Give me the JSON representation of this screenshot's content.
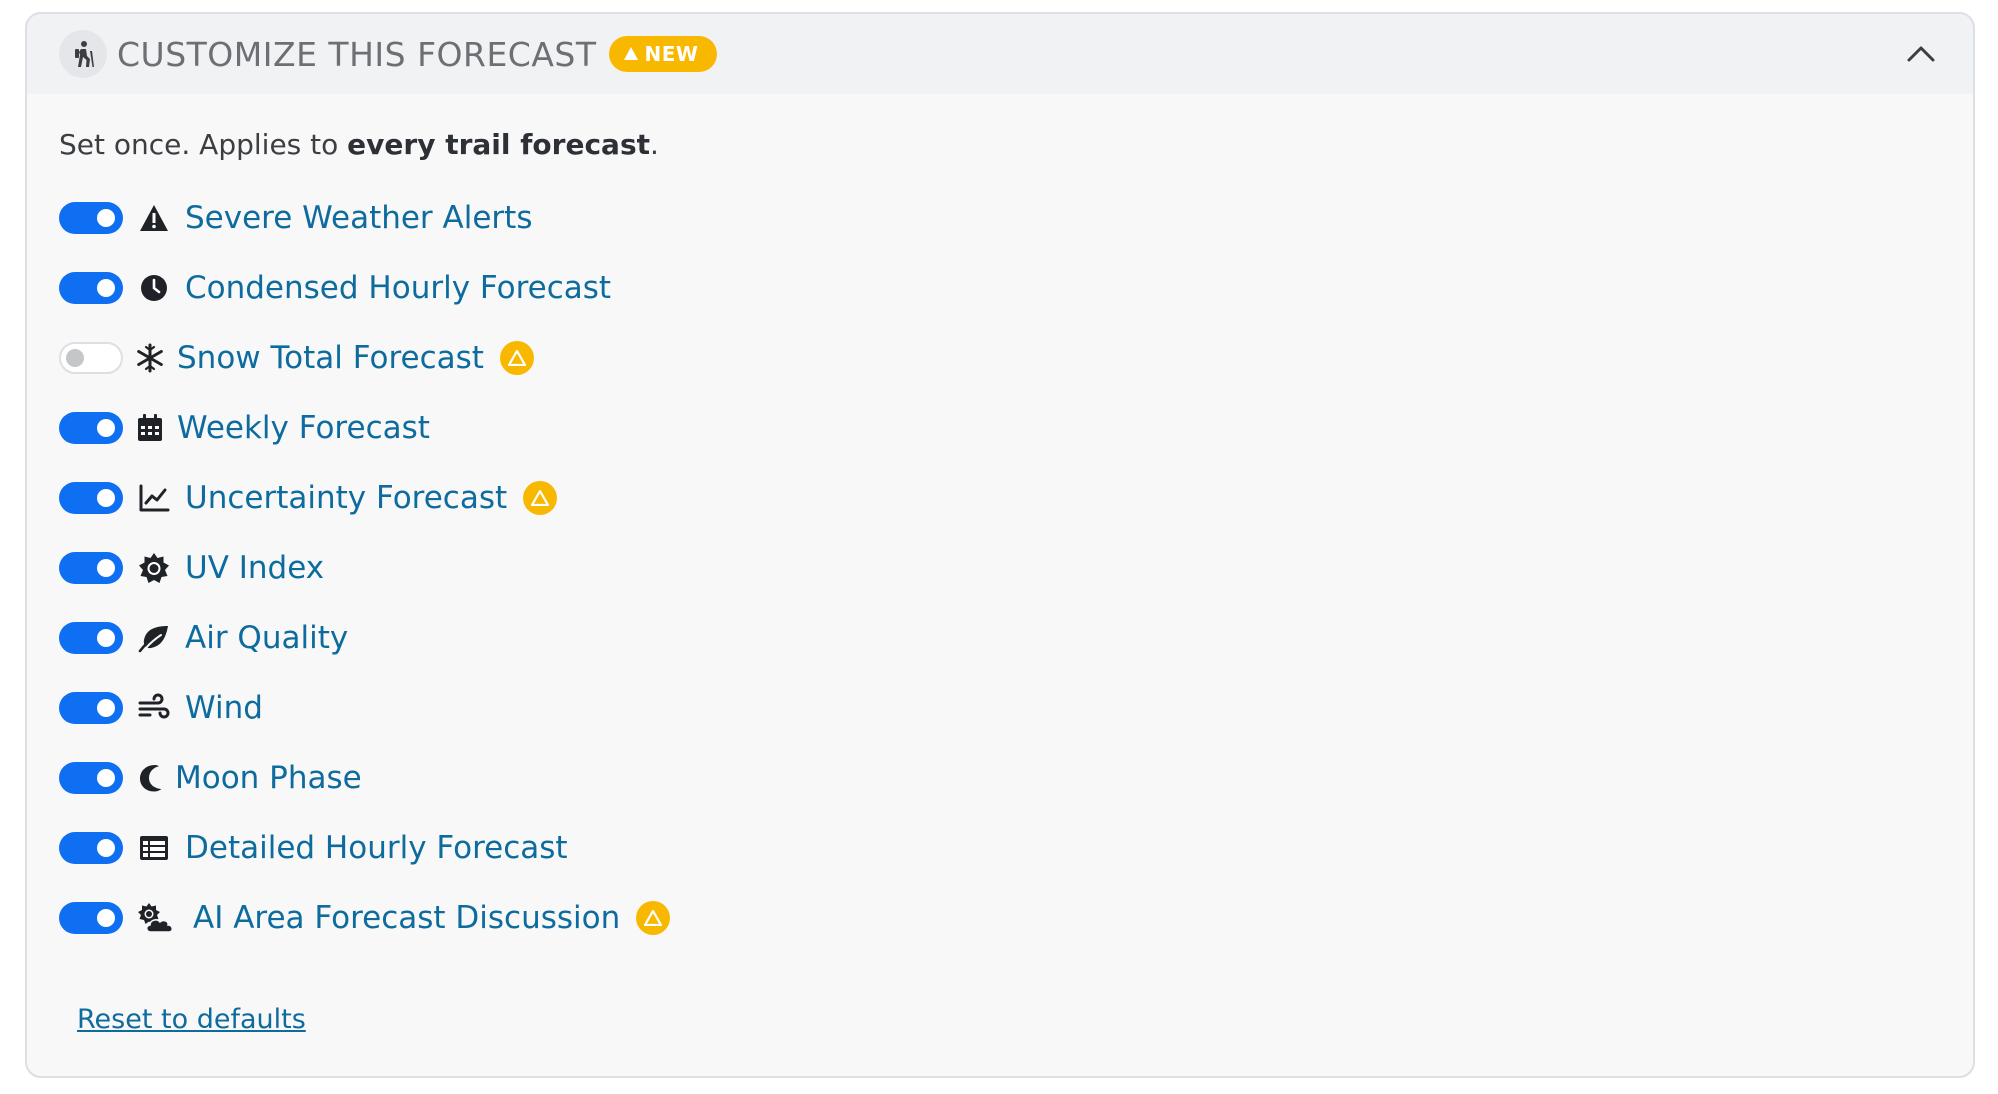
{
  "header": {
    "title": "CUSTOMIZE THIS FORECAST",
    "badge": "NEW",
    "icon": "hiker-icon",
    "collapse_icon": "chevron-up-icon"
  },
  "intro": {
    "prefix": "Set once. Applies to ",
    "bold": "every trail forecast",
    "suffix": "."
  },
  "options": [
    {
      "label": "Severe Weather Alerts",
      "icon": "warning-triangle-icon",
      "enabled": true,
      "new": false
    },
    {
      "label": "Condensed Hourly Forecast",
      "icon": "clock-icon",
      "enabled": true,
      "new": false
    },
    {
      "label": "Snow Total Forecast",
      "icon": "snowflake-icon",
      "enabled": false,
      "new": true
    },
    {
      "label": "Weekly Forecast",
      "icon": "calendar-icon",
      "enabled": true,
      "new": false
    },
    {
      "label": "Uncertainty Forecast",
      "icon": "line-chart-icon",
      "enabled": true,
      "new": true
    },
    {
      "label": "UV Index",
      "icon": "sun-icon",
      "enabled": true,
      "new": false
    },
    {
      "label": "Air Quality",
      "icon": "leaf-icon",
      "enabled": true,
      "new": false
    },
    {
      "label": "Wind",
      "icon": "wind-icon",
      "enabled": true,
      "new": false
    },
    {
      "label": "Moon Phase",
      "icon": "moon-icon",
      "enabled": true,
      "new": false
    },
    {
      "label": "Detailed Hourly Forecast",
      "icon": "table-icon",
      "enabled": true,
      "new": false
    },
    {
      "label": "AI Area Forecast Discussion",
      "icon": "cloud-sun-icon",
      "enabled": true,
      "new": true
    }
  ],
  "reset_label": "Reset to defaults",
  "colors": {
    "accent": "#0f6ff3",
    "link": "#0d6b9e",
    "badge": "#f9b800"
  }
}
